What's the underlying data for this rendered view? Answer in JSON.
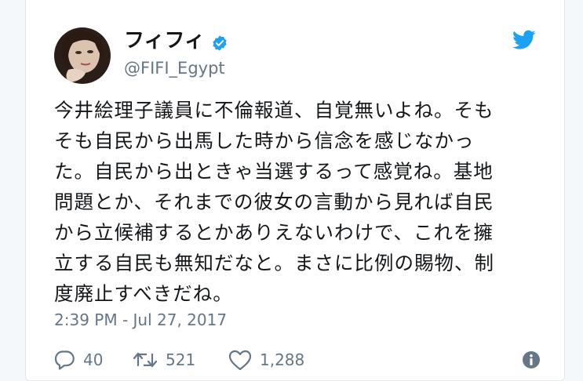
{
  "tweet": {
    "display_name": "フィフィ",
    "handle": "@FIFI_Egypt",
    "verified": true,
    "text": "今井絵理子議員に不倫報道、自覚無いよね。そも\nそも自民から出馬した時から信念を感じなかっ\nた。自民から出ときゃ当選するって感覚ね。基地\n問題とか、それまでの彼女の言動から見れば自民\nから立候補するとかありえないわけで、これを擁\n立する自民も無知だなと。まさに比例の賜物、制\n度廃止すべきだね。",
    "timestamp": "2:39 PM - Jul 27, 2017"
  },
  "actions": {
    "reply_count": "40",
    "retweet_count": "521",
    "like_count": "1,288"
  },
  "icons": {
    "verified": "verified-badge-icon",
    "brand": "twitter-bird-icon",
    "reply": "reply-icon",
    "retweet": "retweet-icon",
    "like": "heart-icon",
    "info": "info-icon"
  },
  "colors": {
    "brand_blue": "#1da1f2",
    "secondary_text": "#657786",
    "primary_text": "#14171a"
  }
}
